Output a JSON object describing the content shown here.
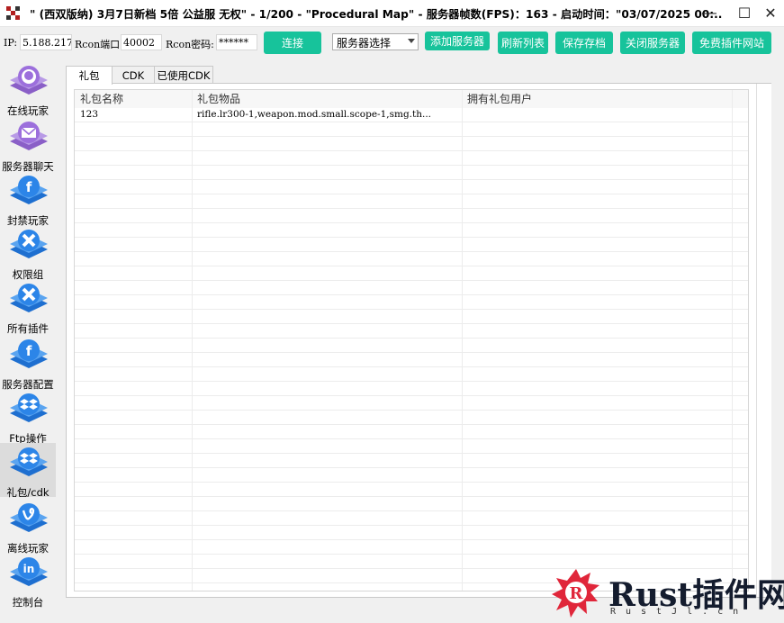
{
  "window": {
    "title": "\" (西双版纳) 3月7日新档 5倍 公益服  无权\"  -  1/200  -  \"Procedural Map\"  -  服务器帧数(FPS)：163  -  启动时间：\"03/07/2025 00:...",
    "minimize_glyph": "—",
    "maximize_glyph": "☐",
    "close_glyph": "✕"
  },
  "toolbar": {
    "ip_label": "IP:",
    "ip_value": "5.188.217",
    "rcon_port_label": "Rcon端口:",
    "rcon_port_value": "40002",
    "rcon_pass_label": "Rcon密码:",
    "rcon_pass_value": "******",
    "connect_label": "连接",
    "server_select": "服务器选择",
    "add_server_label": "添加服务器",
    "refresh_label": "刷新列表",
    "save_label": "保存存档",
    "shutdown_label": "关闭服务器",
    "plugin_site_label": "免费插件网站",
    "accent_color": "#17c39b"
  },
  "sidebar": {
    "items": [
      {
        "label": "在线玩家",
        "icon": "online-players-icon"
      },
      {
        "label": "服务器聊天",
        "icon": "mail-icon"
      },
      {
        "label": "封禁玩家",
        "icon": "facebook-icon"
      },
      {
        "label": "权限组",
        "icon": "x-icon"
      },
      {
        "label": "所有插件",
        "icon": "x-icon"
      },
      {
        "label": "服务器配置",
        "icon": "facebook-icon"
      },
      {
        "label": "Ftp操作",
        "icon": "dropbox-icon"
      },
      {
        "label": "礼包/cdk",
        "icon": "dropbox-icon"
      },
      {
        "label": "离线玩家",
        "icon": "vine-icon"
      },
      {
        "label": "控制台",
        "icon": "linkedin-icon"
      }
    ],
    "active_index": 7
  },
  "tabs": [
    {
      "label": "礼包"
    },
    {
      "label": "CDK"
    },
    {
      "label": "已使用CDK"
    }
  ],
  "table": {
    "columns": [
      "礼包名称",
      "礼包物品",
      "拥有礼包用户"
    ],
    "rows": [
      [
        "123",
        "rifle.lr300-1,weapon.mod.small.scope-1,smg.th...",
        ""
      ]
    ]
  },
  "watermark": {
    "logo_text": "Rust插件网",
    "sub_text": "RustJl.cn"
  }
}
